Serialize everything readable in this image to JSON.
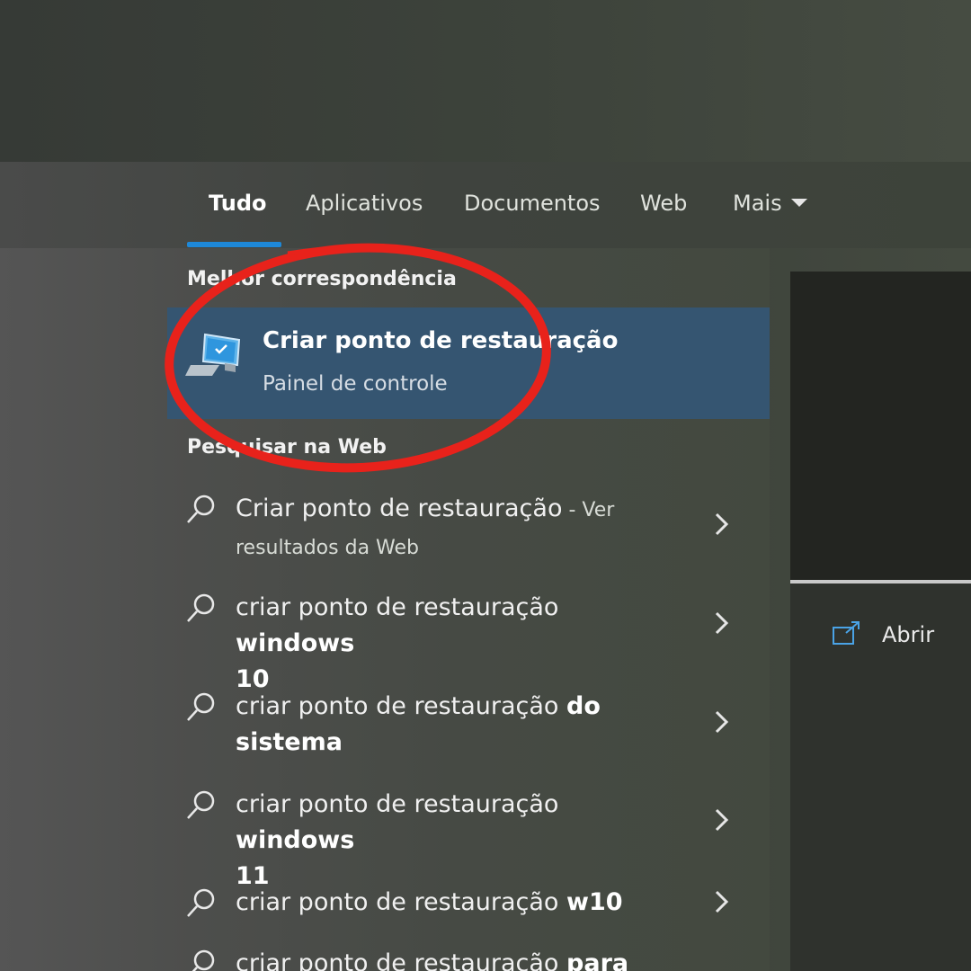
{
  "tabs": [
    {
      "label": "Tudo",
      "active": true
    },
    {
      "label": "Aplicativos"
    },
    {
      "label": "Documentos"
    },
    {
      "label": "Web"
    },
    {
      "label": "Mais"
    }
  ],
  "best_match": {
    "section_title": "Melhor correspondência",
    "title": "Criar ponto de restauração",
    "subtitle": "Painel de controle",
    "icon": "system-computer-icon"
  },
  "web_search": {
    "section_title": "Pesquisar na Web",
    "items": [
      {
        "text": "Criar ponto de restauração",
        "suffix": " - Ver",
        "line2": "resultados da Web"
      },
      {
        "text": "criar ponto de restauração ",
        "bold": "windows",
        "line2": "10"
      },
      {
        "text": "criar ponto de restauração ",
        "bold": "do",
        "line2": "sistema"
      },
      {
        "text": "criar ponto de restauração ",
        "bold": "windows",
        "line2": "11"
      },
      {
        "text": "criar ponto de restauração ",
        "bold": "w10"
      },
      {
        "text": "criar ponto de restauração ",
        "bold": "para data"
      }
    ]
  },
  "preview": {
    "open_label": "Abrir",
    "open_icon": "open-external-icon"
  },
  "colors": {
    "accent": "#1e88d8",
    "selected_bg": "#355571",
    "highlight_circle": "#e8221b"
  }
}
